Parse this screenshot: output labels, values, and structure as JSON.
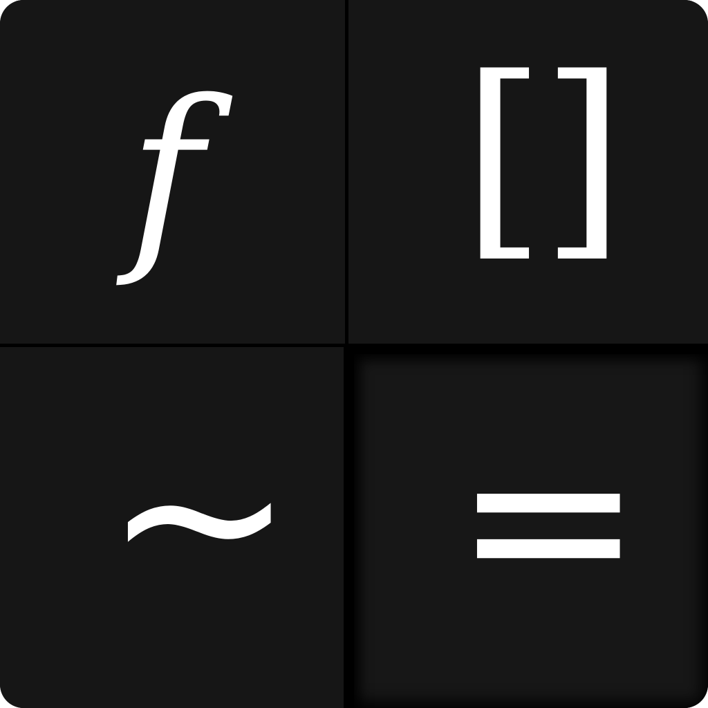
{
  "app_icon": {
    "name": "formula-app-icon",
    "background_color": "#000000",
    "tile_color": "#161616",
    "glyph_color": "#ffffff",
    "tiles": [
      {
        "id": "function",
        "symbol": "f",
        "icon": "function-icon"
      },
      {
        "id": "brackets",
        "symbol": "[]",
        "icon": "brackets-icon"
      },
      {
        "id": "tilde",
        "symbol": "~",
        "icon": "tilde-icon"
      },
      {
        "id": "equals",
        "symbol": "=",
        "icon": "equals-icon"
      }
    ]
  }
}
